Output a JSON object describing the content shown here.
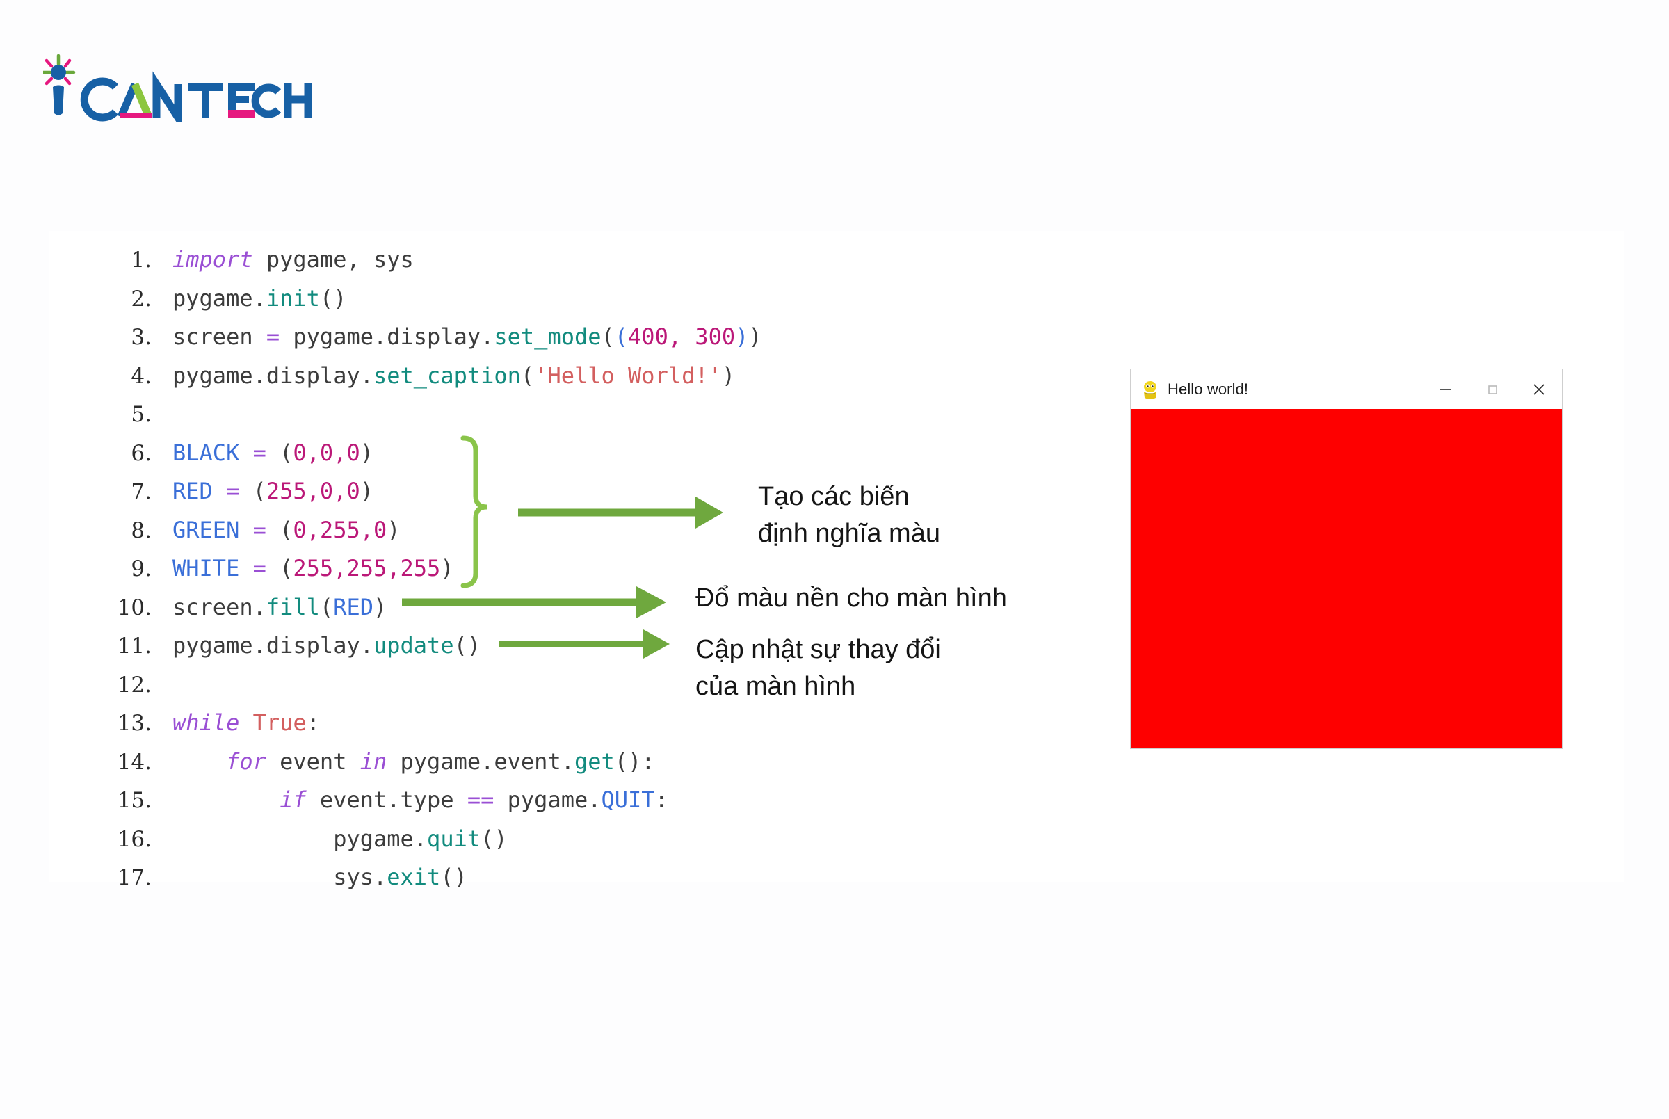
{
  "brand": {
    "name": "iCAN TECH",
    "part_i": "i",
    "part_can": "CAN",
    "part_tech": "TECH",
    "colors": {
      "blue": "#1760a5",
      "green": "#8cc63f",
      "pink": "#e6187f"
    }
  },
  "code_panel": {
    "language": "python",
    "lines": [
      {
        "n": "1.",
        "tokens": [
          {
            "t": "import",
            "c": "kw"
          },
          {
            "t": " pygame, sys",
            "c": "pl"
          }
        ]
      },
      {
        "n": "2.",
        "tokens": [
          {
            "t": "pygame.",
            "c": "pl"
          },
          {
            "t": "init",
            "c": "fn"
          },
          {
            "t": "()",
            "c": "pl"
          }
        ]
      },
      {
        "n": "3.",
        "tokens": [
          {
            "t": "screen ",
            "c": "pl"
          },
          {
            "t": "=",
            "c": "op"
          },
          {
            "t": " pygame.display.",
            "c": "pl"
          },
          {
            "t": "set_mode",
            "c": "fn"
          },
          {
            "t": "(",
            "c": "pl"
          },
          {
            "t": "(",
            "c": "cst"
          },
          {
            "t": "400",
            "c": "num"
          },
          {
            "t": ", ",
            "c": "num"
          },
          {
            "t": "300",
            "c": "num"
          },
          {
            "t": ")",
            "c": "cst"
          },
          {
            "t": ")",
            "c": "pl"
          }
        ]
      },
      {
        "n": "4.",
        "tokens": [
          {
            "t": "pygame.display.",
            "c": "pl"
          },
          {
            "t": "set_caption",
            "c": "fn"
          },
          {
            "t": "(",
            "c": "pl"
          },
          {
            "t": "'Hello World!'",
            "c": "str"
          },
          {
            "t": ")",
            "c": "pl"
          }
        ]
      },
      {
        "n": "5.",
        "tokens": []
      },
      {
        "n": "6.",
        "tokens": [
          {
            "t": "BLACK ",
            "c": "cst"
          },
          {
            "t": "=",
            "c": "op"
          },
          {
            "t": " (",
            "c": "pl"
          },
          {
            "t": "0,0,0",
            "c": "num"
          },
          {
            "t": ")",
            "c": "pl"
          }
        ]
      },
      {
        "n": "7.",
        "tokens": [
          {
            "t": "RED ",
            "c": "cst"
          },
          {
            "t": "=",
            "c": "op"
          },
          {
            "t": " (",
            "c": "pl"
          },
          {
            "t": "255,0,0",
            "c": "num"
          },
          {
            "t": ")",
            "c": "pl"
          }
        ]
      },
      {
        "n": "8.",
        "tokens": [
          {
            "t": "GREEN ",
            "c": "cst"
          },
          {
            "t": "=",
            "c": "op"
          },
          {
            "t": " (",
            "c": "pl"
          },
          {
            "t": "0,255,0",
            "c": "num"
          },
          {
            "t": ")",
            "c": "pl"
          }
        ]
      },
      {
        "n": "9.",
        "tokens": [
          {
            "t": "WHITE ",
            "c": "cst"
          },
          {
            "t": "=",
            "c": "op"
          },
          {
            "t": " (",
            "c": "pl"
          },
          {
            "t": "255,255,255",
            "c": "num"
          },
          {
            "t": ")",
            "c": "pl"
          }
        ]
      },
      {
        "n": "10.",
        "tokens": [
          {
            "t": "screen.",
            "c": "pl"
          },
          {
            "t": "fill",
            "c": "fn"
          },
          {
            "t": "(",
            "c": "pl"
          },
          {
            "t": "RED",
            "c": "cst"
          },
          {
            "t": ")",
            "c": "pl"
          }
        ]
      },
      {
        "n": "11.",
        "tokens": [
          {
            "t": "pygame.display.",
            "c": "pl"
          },
          {
            "t": "update",
            "c": "fn"
          },
          {
            "t": "()",
            "c": "pl"
          }
        ]
      },
      {
        "n": "12.",
        "tokens": []
      },
      {
        "n": "13.",
        "tokens": [
          {
            "t": "while",
            "c": "kw"
          },
          {
            "t": " ",
            "c": "pl"
          },
          {
            "t": "True",
            "c": "str"
          },
          {
            "t": ":",
            "c": "pl"
          }
        ]
      },
      {
        "n": "14.",
        "tokens": [
          {
            "t": "    ",
            "c": "pl"
          },
          {
            "t": "for",
            "c": "kw"
          },
          {
            "t": " event ",
            "c": "pl"
          },
          {
            "t": "in",
            "c": "kw"
          },
          {
            "t": " pygame.event.",
            "c": "pl"
          },
          {
            "t": "get",
            "c": "fn"
          },
          {
            "t": "():",
            "c": "pl"
          }
        ]
      },
      {
        "n": "15.",
        "tokens": [
          {
            "t": "        ",
            "c": "pl"
          },
          {
            "t": "if",
            "c": "kw"
          },
          {
            "t": " event.type ",
            "c": "pl"
          },
          {
            "t": "==",
            "c": "op"
          },
          {
            "t": " pygame.",
            "c": "pl"
          },
          {
            "t": "QUIT",
            "c": "cst"
          },
          {
            "t": ":",
            "c": "pl"
          }
        ]
      },
      {
        "n": "16.",
        "tokens": [
          {
            "t": "            pygame.",
            "c": "pl"
          },
          {
            "t": "quit",
            "c": "fn"
          },
          {
            "t": "()",
            "c": "pl"
          }
        ]
      },
      {
        "n": "17.",
        "tokens": [
          {
            "t": "            sys.",
            "c": "pl"
          },
          {
            "t": "exit",
            "c": "fn"
          },
          {
            "t": "()",
            "c": "pl"
          }
        ]
      }
    ]
  },
  "annotations": {
    "accent_color": "#6fa83e",
    "items": [
      {
        "id": "annot-variables",
        "text": "Tạo các biến\nđịnh nghĩa màu",
        "target_lines": "6-9"
      },
      {
        "id": "annot-fill",
        "text": "Đổ màu nền cho màn hình",
        "target_lines": "10"
      },
      {
        "id": "annot-update",
        "text": "Cập nhật sự thay đổi\ncủa màn hình",
        "target_lines": "11"
      }
    ]
  },
  "pygame_window": {
    "title": "Hello world!",
    "icon": "pygame-logo-icon",
    "canvas_color": "#fe0000",
    "controls": {
      "minimize": "–",
      "maximize": "▢",
      "close": "✕"
    }
  }
}
